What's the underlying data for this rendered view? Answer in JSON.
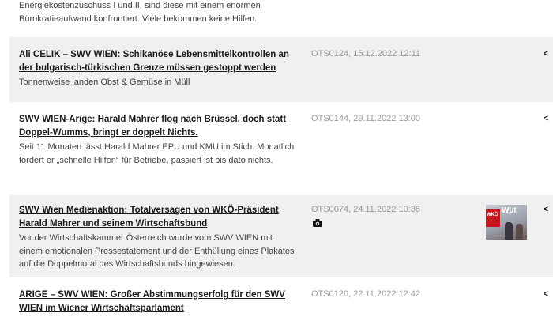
{
  "top_fragment": {
    "desc": "Energiekostenzuschuss I und II, sind diese mit einem enormen Bürokratieaufwand konfrontiert. Viele bekommen keine Hilfen."
  },
  "items": [
    {
      "title": "Ali CELIK – SWV WIEN: Schikanöse Lebensmittelkontrollen an der bulgarisch-türkischen Grenze müssen gestoppt werden",
      "desc": "Tonnenweise landen Obst & Gemüse in Müll",
      "meta": "OTS0124, 15.12.2022 12:11"
    },
    {
      "title": "SWV WIEN-Arige: Harald Mahrer flog nach Brüssel, doch statt Doppel-Wumms, bringt er doppelt Nichts.",
      "desc": "Seit 11 Monaten lässt Harald Mahrer EPU und KMU im Stich. Monatlich fordert er „schnelle Hilfen“ für Betriebe, passiert ist bis dato nichts.",
      "meta": "OTS0144, 29.11.2022 13:00"
    },
    {
      "title": "SWV Wien Medienaktion: Totalversagen von WKÖ-Präsident Harald Mahrer und seinem Wirtschaftsbund",
      "desc": "Vor der Wirtschaftskammer Österreich wurde vom SWV WIEN mit einem emotionalen Pressestatement und der Enthüllung eines Plakates auf die Doppelmoral des Wirtschaftsbunds hingewiesen.",
      "meta": "OTS0074, 24.11.2022 10:36",
      "thumb_text_1": "Wut",
      "thumb_text_2": "WKÖ"
    },
    {
      "title": "ARIGE – SWV WIEN: Großer Abstimmungserfolg für den SWV WIEN im Wiener Wirtschaftsparlament",
      "meta": "OTS0120, 22.11.2022 12:42"
    }
  ],
  "icons": {
    "share": "share-icon",
    "camera": "camera-icon"
  },
  "colors": {
    "grey_bg": "#f0f0f0",
    "meta_text": "#9a9a9a"
  }
}
